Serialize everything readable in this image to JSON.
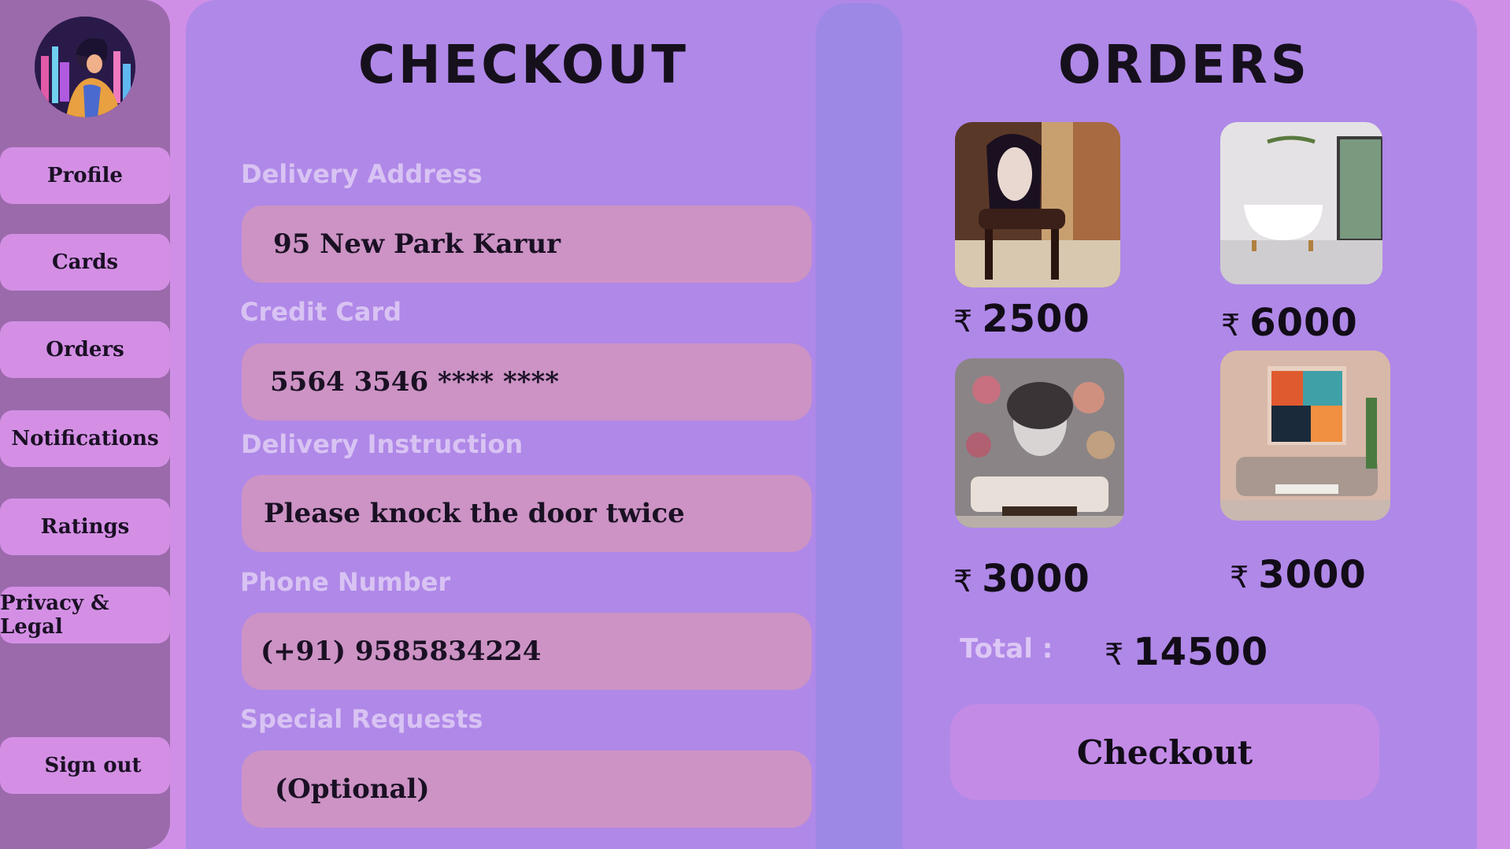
{
  "sidebar": {
    "items": [
      {
        "label": "Profile"
      },
      {
        "label": "Cards"
      },
      {
        "label": "Orders"
      },
      {
        "label": "Notifications"
      },
      {
        "label": "Ratings"
      },
      {
        "label": "Privacy & Legal"
      }
    ],
    "sign_out": "Sign out"
  },
  "checkout": {
    "title": "CHECKOUT",
    "fields": [
      {
        "label": "Delivery Address",
        "value": "95 New Park Karur"
      },
      {
        "label": "Credit Card",
        "value": "5564 3546 **** ****"
      },
      {
        "label": "Delivery Instruction",
        "value": "Please knock the door twice"
      },
      {
        "label": "Phone Number",
        "value": "(+91) 9585834224"
      },
      {
        "label": "Special Requests",
        "value": "(Optional)"
      }
    ]
  },
  "orders": {
    "title": "ORDERS",
    "currency": "₹",
    "items": [
      {
        "image": "ornate-chair",
        "price": "2500"
      },
      {
        "image": "bathtub-room",
        "price": "6000"
      },
      {
        "image": "floral-portrait-living-room",
        "price": "3000"
      },
      {
        "image": "abstract-art-living-room",
        "price": "3000"
      }
    ],
    "total_label": "Total :",
    "total": "14500",
    "checkout_label": "Checkout"
  },
  "colors": {
    "background": "#cf8fe6",
    "sidebar": "#9b6aab",
    "panel": "#b088e8",
    "field": "#cc93c4",
    "nav_button": "#d48fe5",
    "checkout_button": "#c38be6"
  }
}
